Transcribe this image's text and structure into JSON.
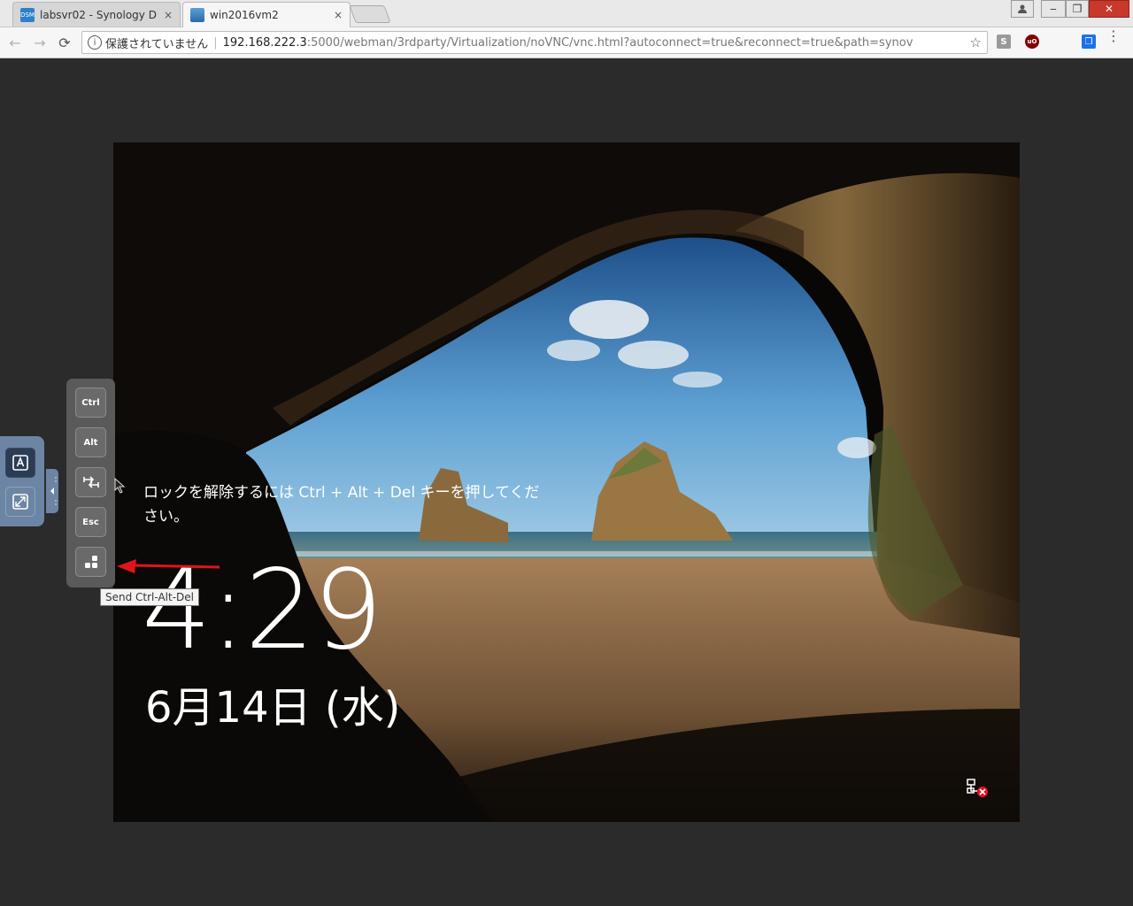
{
  "browser": {
    "tabs": [
      {
        "title": "labsvr02 - Synology D",
        "favicon": "dsm-icon",
        "close": "×",
        "active": false
      },
      {
        "title": "win2016vm2",
        "favicon": "vm-icon",
        "close": "×",
        "active": true
      }
    ],
    "window_controls": {
      "user": "user-icon",
      "minimize": "‒",
      "restore": "❐",
      "close": "✕"
    },
    "nav": {
      "back": "←",
      "forward": "→",
      "reload": "⟳"
    },
    "address": {
      "info_icon": "i",
      "security_label": "保護されていません",
      "separator": "|",
      "host": "192.168.222.3",
      "path": ":5000/webman/3rdparty/Virtualization/noVNC/vnc.html?autoconnect=true&reconnect=true&path=synov",
      "star": "☆"
    },
    "extensions": [
      {
        "name": "s-extension-icon",
        "label": "S",
        "color": "#9a9a9a"
      },
      {
        "name": "ublock-icon",
        "label": "uO",
        "color": "#800000"
      },
      {
        "name": "extension-icon",
        "label": "❒",
        "color": "#1a73e8"
      }
    ],
    "menu": "⋮"
  },
  "vnc": {
    "lock_message": "ロックを解除するには Ctrl + Alt + Del キーを押してください。",
    "time": "4:29",
    "date": "6月14日 (水)"
  },
  "novnc": {
    "controlbar_buttons": [
      "keyboard-icon",
      "fullscreen-icon"
    ],
    "keys": [
      {
        "label": "Ctrl"
      },
      {
        "label": "Alt"
      },
      {
        "label": "Tab"
      },
      {
        "label": "Esc"
      },
      {
        "label": "Ctrl-Alt-Del"
      }
    ],
    "tooltip": "Send Ctrl-Alt-Del"
  },
  "colors": {
    "annotation_arrow": "#e0141b",
    "controlbar": "#6c85a4",
    "keys_panel": "#5a5a5a"
  }
}
